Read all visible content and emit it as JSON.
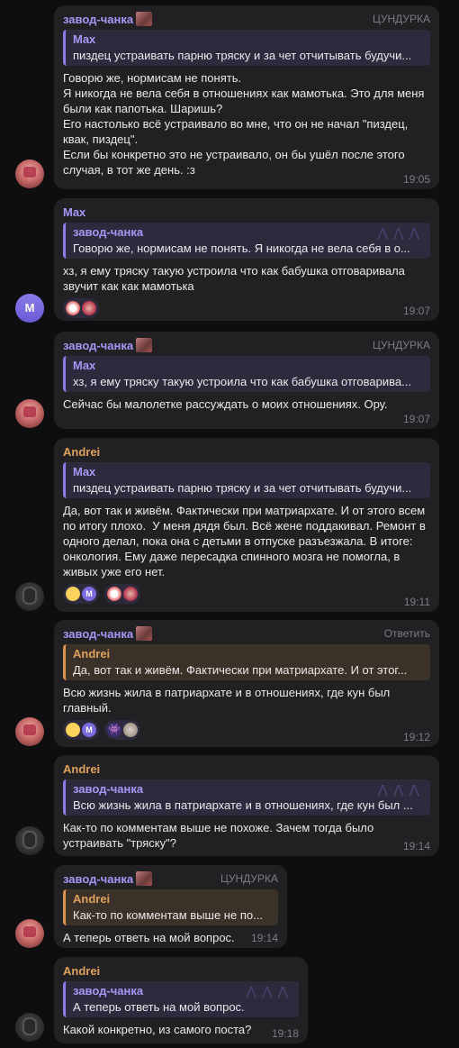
{
  "messages": [
    {
      "sender": "завод-чанка",
      "tag": "ЦУНДУРКА",
      "reply": {
        "name": "Max",
        "text": "пиздец устраивать парню тряску и за чет отчитывать будучи..."
      },
      "text": "Говорю же, нормисам не понять.\nЯ никогда не вела себя в отношениях как мамотька. Это для меня были как папотька. Шаришь?\nЕго настолько всё устраивало во мне, что он не начал \"пиздец, квак, пиздец\".\nЕсли бы конкретно это не устраивало, он бы ушёл после этого случая, в тот же день. :з",
      "time": "19:05"
    },
    {
      "sender": "Max",
      "avatar_letter": "M",
      "reply": {
        "name": "завод-чанка",
        "text": "Говорю же, нормисам не понять.  Я никогда не вела себя в о..."
      },
      "text": "хз, я ему тряску такую устроила что как бабушка отговаривала звучит как как мамотька",
      "time": "19:07"
    },
    {
      "sender": "завод-чанка",
      "tag": "ЦУНДУРКА",
      "reply": {
        "name": "Max",
        "text": "хз, я ему тряску такую устроила что как бабушка отговарива..."
      },
      "text": "Сейчас бы малолетке рассуждать о моих отношениях. Ору.",
      "time": "19:07"
    },
    {
      "sender": "Andrei",
      "reply": {
        "name": "Max",
        "text": "пиздец устраивать парню тряску и за чет отчитывать будучи..."
      },
      "text": "Да, вот так и живём. Фактически при матриархате. И от этого всем по итогу плохо.  У меня дядя был. Всё жене поддакивал. Ремонт в одного делал, пока она с детьми в отпуске разъезжала. В итоге: онкология. Ему даже пересадка спинного мозга не помогла, в живых уже его нет.",
      "time": "19:11"
    },
    {
      "sender": "завод-чанка",
      "tag": "Ответить",
      "reply": {
        "name": "Andrei",
        "text": "Да, вот так и живём. Фактически при матриархате. И от этог..."
      },
      "text": "Всю жизнь жила в патриархате и в отношениях, где кун был главный.",
      "time": "19:12"
    },
    {
      "sender": "Andrei",
      "reply": {
        "name": "завод-чанка",
        "text": "Всю жизнь жила в патриархате и в отношениях, где кун был ..."
      },
      "text": "Как-то по комментам выше не похоже. Зачем тогда было устраивать \"тряску\"?",
      "time": "19:14"
    },
    {
      "sender": "завод-чанка",
      "tag": "ЦУНДУРКА",
      "reply": {
        "name": "Andrei",
        "text": "Как-то по комментам выше не по..."
      },
      "text": "А теперь ответь на мой вопрос.",
      "time": "19:14"
    },
    {
      "sender": "Andrei",
      "reply": {
        "name": "завод-чанка",
        "text": "А теперь ответь на мой вопрос."
      },
      "text": "Какой конкретно, из самого поста?",
      "time": "19:18"
    }
  ],
  "colors": {
    "background": "#0e0e10",
    "bubble": "#212124",
    "name_purple": "#a895f5",
    "name_orange": "#e1a15e",
    "muted": "#7c7c82"
  },
  "icons": {
    "sticker": "sticker-icon",
    "bats": "bat-pattern-icon",
    "reactions": [
      "clown-emoji",
      "crying-emoji",
      "grin-emoji",
      "space-invader-emoji"
    ]
  }
}
